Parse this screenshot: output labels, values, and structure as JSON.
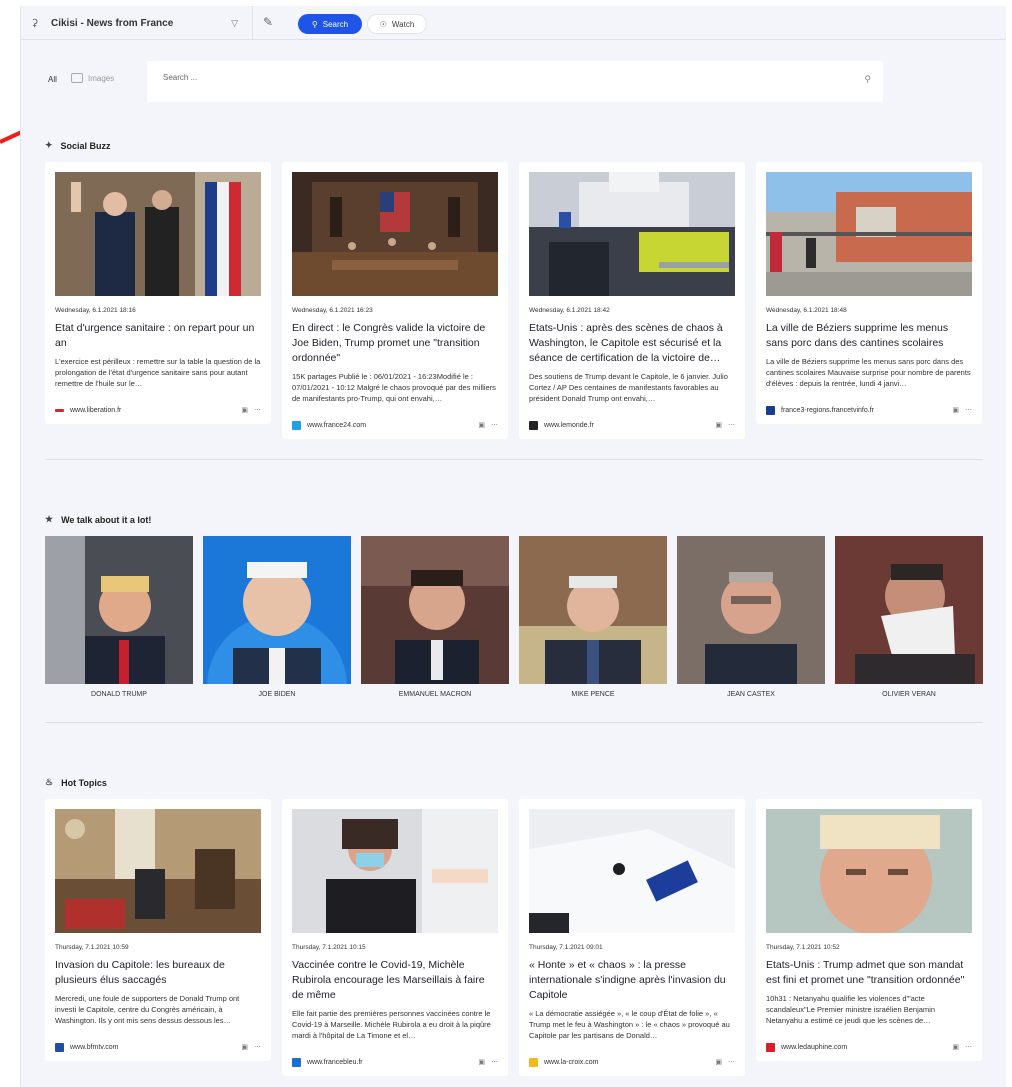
{
  "app": {
    "workspace_name": "Cikisi - News from France",
    "tabs": {
      "search": "Search",
      "watch": "Watch"
    }
  },
  "filters": {
    "all": "All",
    "images": "Images"
  },
  "search": {
    "placeholder": "Search ..."
  },
  "sections": {
    "social_buzz": {
      "title": "Social Buzz",
      "cards": [
        {
          "date": "Wednesday, 6.1.2021 18:16",
          "title": "Etat d'urgence sanitaire : on repart pour un an",
          "desc": "L'exercice est périlleux : remettre sur la table la question de la prolongation de l'état d'urgence sanitaire sans pour autant remettre de l'huile sur le…",
          "source": "www.liberation.fr",
          "fav_color": "#e5202e"
        },
        {
          "date": "Wednesday, 6.1.2021 16:23",
          "title": "En direct : le Congrès valide la victoire de Joe Biden, Trump promet une \"transition ordonnée\"",
          "desc": "15K partages Publié le : 06/01/2021 - 16:23Modifié le : 07/01/2021 - 10:12 Malgré le chaos provoqué par des milliers de manifestants pro-Trump, qui ont envahi,…",
          "source": "www.france24.com",
          "fav_color": "#1aa3e0"
        },
        {
          "date": "Wednesday, 6.1.2021 18:42",
          "title": "Etats-Unis : après des scènes de chaos à Washington, le Capitole est sécurisé et la séance de certification de la victoire de…",
          "desc": "Des soutiens de Trump devant le Capitole, le 6 janvier. Julio Cortez / AP Des centaines de manifestants favorables au président Donald Trump ont envahi,…",
          "source": "www.lemonde.fr",
          "fav_color": "#222222"
        },
        {
          "date": "Wednesday, 6.1.2021 18:48",
          "title": "La ville de Béziers supprime les menus sans porc dans des cantines scolaires",
          "desc": "La ville de Béziers supprime les menus sans porc dans des cantines scolaires Mauvaise surprise pour nombre de parents d'élèves : depuis la rentrée, lundi 4 janvi…",
          "source": "france3-regions.francetvinfo.fr",
          "fav_color": "#1a3d8f"
        }
      ]
    },
    "we_talk": {
      "title": "We talk about it a lot!",
      "people": [
        {
          "name": "DONALD TRUMP"
        },
        {
          "name": "JOE BIDEN"
        },
        {
          "name": "EMMANUEL MACRON"
        },
        {
          "name": "MIKE PENCE"
        },
        {
          "name": "JEAN CASTEX"
        },
        {
          "name": "OLIVIER VERAN"
        }
      ]
    },
    "hot_topics": {
      "title": "Hot Topics",
      "cards": [
        {
          "date": "Thursday, 7.1.2021 10:59",
          "title": "Invasion du Capitole: les bureaux de plusieurs élus saccagés",
          "desc": "Mercredi, une foule de supporters de Donald Trump ont investi le Capitole, centre du Congrès américain, à Washington. Ils y ont mis sens dessus dessous les…",
          "source": "www.bfmtv.com",
          "fav_color": "#1f4ea3"
        },
        {
          "date": "Thursday, 7.1.2021 10:15",
          "title": "Vaccinée contre le Covid-19, Michèle Rubirola encourage les Marseillais à faire de même",
          "desc": "Elle fait partie des premières personnes vaccinées contre le Covid-19 à Marseille. Michèle Rubirola a eu droit à la piqûre mardi à l'hôpital de La Timone et el…",
          "source": "www.francebleu.fr",
          "fav_color": "#1b6fd1"
        },
        {
          "date": "Thursday, 7.1.2021 09:01",
          "title": "« Honte » et « chaos » : la presse internationale s'indigne après l'invasion du Capitole",
          "desc": "« La démocratie assiégée », « le coup d'État de folie », « Trump met le feu à Washington » : le « chaos » provoqué au Capitole par les partisans de Donald…",
          "source": "www.la-croix.com",
          "fav_color": "#f2b81f"
        },
        {
          "date": "Thursday, 7.1.2021 10:52",
          "title": "Etats-Unis : Trump admet que son mandat est fini et promet une \"transition ordonnée\"",
          "desc": "10h31 : Netanyahu qualifie les violences d'\"acte scandaleux\"Le Premier ministre israélien Benjamin Netanyahu a estimé ce jeudi que les scènes de…",
          "source": "www.ledauphine.com",
          "fav_color": "#d8202a"
        }
      ]
    }
  },
  "colors": {
    "accent": "#1e55e6",
    "annotation_arrow": "#ee1c1c"
  }
}
